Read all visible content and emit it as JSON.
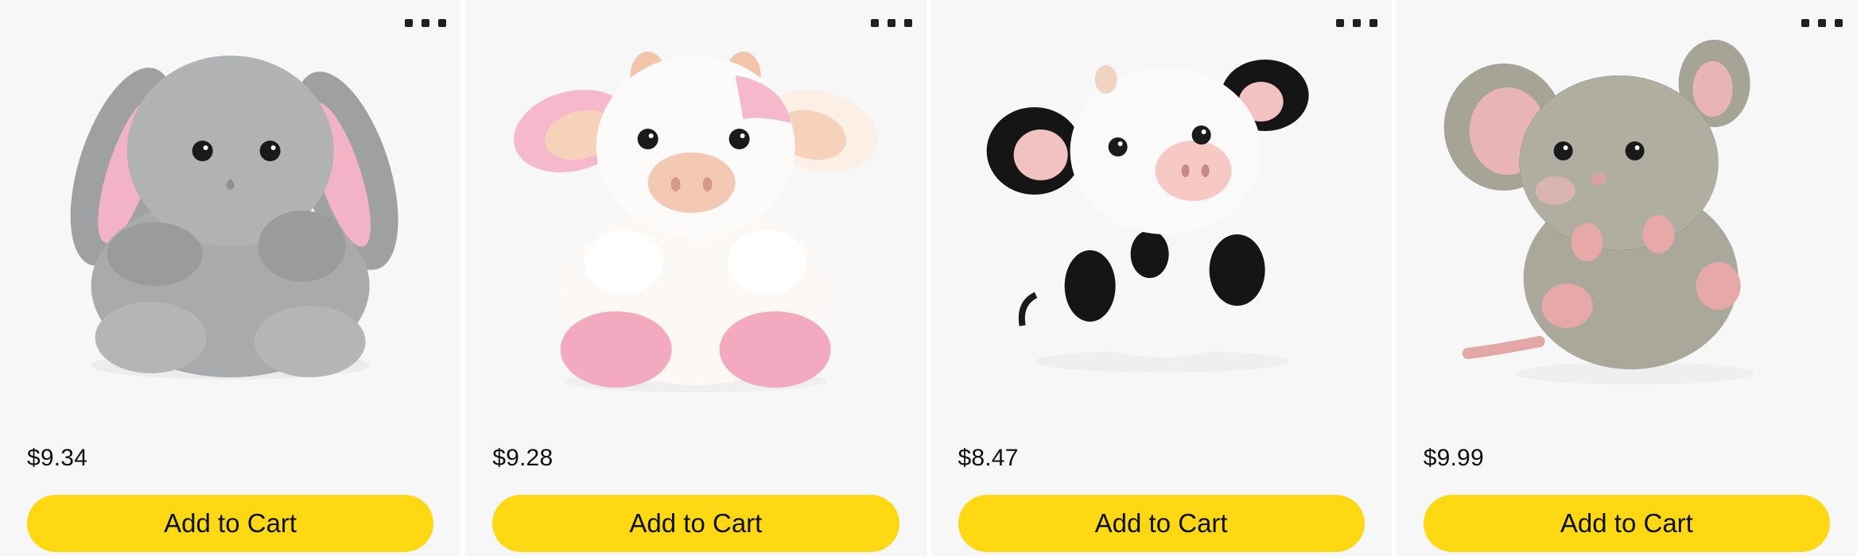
{
  "products": [
    {
      "price": "$9.34",
      "add_label": "Add to Cart",
      "image_icon": "gray-bunny-plush-image",
      "colors": {
        "body": "#a9aaab",
        "shade": "#8f9091",
        "ear_inner": "#f2b3c6",
        "accent": "#f2b3c6"
      }
    },
    {
      "price": "$9.28",
      "add_label": "Add to Cart",
      "image_icon": "pink-cow-plush-image",
      "colors": {
        "body": "#fbf8f5",
        "shade": "#ece6e1",
        "ear_inner": "#f4b9c9",
        "accent": "#f3a9c0"
      }
    },
    {
      "price": "$8.47",
      "add_label": "Add to Cart",
      "image_icon": "black-white-cow-plush-image",
      "colors": {
        "body": "#f7f7f7",
        "shade": "#e7e7e7",
        "ear_inner": "#f2c2c0",
        "accent": "#151515"
      }
    },
    {
      "price": "$9.99",
      "add_label": "Add to Cart",
      "image_icon": "gray-mouse-plush-image",
      "colors": {
        "body": "#aaa79b",
        "shade": "#939084",
        "ear_inner": "#e8b4b6",
        "accent": "#e6a9a7"
      }
    }
  ],
  "more_options_icon": "more-options-icon",
  "accent_button_color": "#ffd814"
}
